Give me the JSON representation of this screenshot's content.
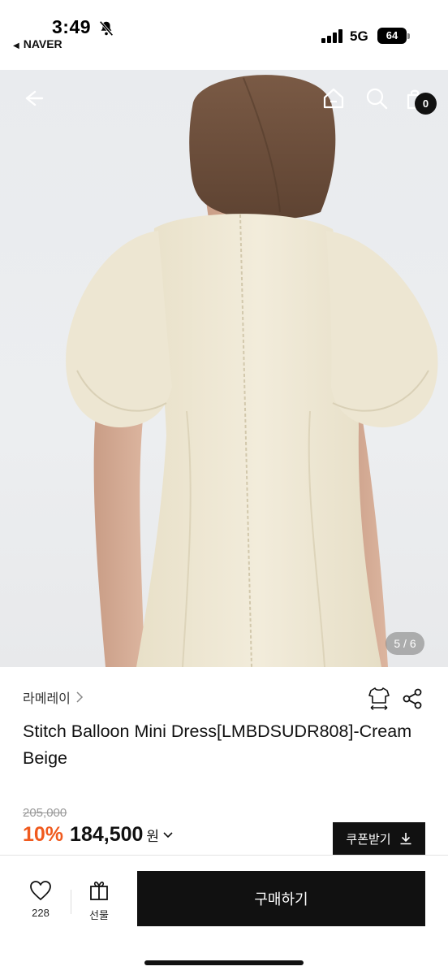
{
  "status_bar": {
    "time": "3:49",
    "back_app": "NAVER",
    "network": "5G",
    "battery": "64"
  },
  "product_image": {
    "counter": "5 / 6",
    "cart_count": "0"
  },
  "icons": {
    "back": "arrow-left-icon",
    "home": "home-icon",
    "search": "search-icon",
    "cart": "shopping-bag-icon",
    "size": "shirt-size-icon",
    "share": "share-icon",
    "download": "download-icon",
    "heart": "heart-icon",
    "gift": "gift-icon"
  },
  "product": {
    "brand": "라메레이",
    "title": "Stitch Balloon Mini Dress[LMBDSUDR808]-Cream Beige",
    "original_price": "205,000",
    "discount": "10%",
    "price": "184,500",
    "currency": "원",
    "coupon_label": "쿠폰받기"
  },
  "bottom_bar": {
    "like_count": "228",
    "gift_label": "선물",
    "buy_label": "구매하기"
  },
  "colors": {
    "accent": "#f05a1e",
    "button": "#111111",
    "dress": "#f0ead8"
  }
}
